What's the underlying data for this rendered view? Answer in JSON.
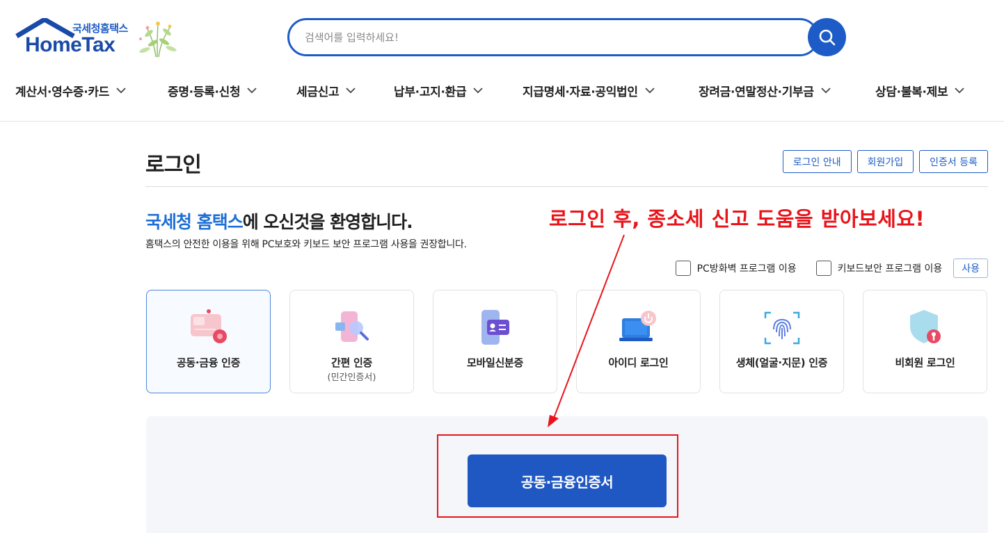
{
  "header": {
    "logo_sub": "국세청홈택스",
    "logo_main": "HomeTax",
    "search_placeholder": "검색어를 입력하세요!",
    "search_icon": "search-icon"
  },
  "nav": [
    {
      "label": "계산서·영수증·카드"
    },
    {
      "label": "증명·등록·신청"
    },
    {
      "label": "세금신고"
    },
    {
      "label": "납부·고지·환급"
    },
    {
      "label": "지급명세·자료·공익법인"
    },
    {
      "label": "장려금·연말정산·기부금"
    },
    {
      "label": "상담·불복·제보"
    }
  ],
  "login": {
    "title": "로그인",
    "buttons": {
      "guide": "로그인 안내",
      "join": "회원가입",
      "cert_register": "인증서 등록"
    },
    "welcome_accent": "국세청 홈택스",
    "welcome_rest": "에 오신것을 환영합니다.",
    "welcome_sub": "홈택스의 안전한 이용을 위해 PC보호와 키보드 보안 프로그램 사용을 권장합니다.",
    "check_firewall": "PC방화벽 프로그램 이용",
    "check_keyboard": "키보드보안 프로그램 이용",
    "use_button": "사용",
    "methods": [
      {
        "label": "공동·금융 인증",
        "sub": "",
        "icon": "certificate-card-icon"
      },
      {
        "label": "간편 인증",
        "sub": "(민간인증서)",
        "icon": "simple-auth-icon"
      },
      {
        "label": "모바일신분증",
        "sub": "",
        "icon": "mobile-id-icon"
      },
      {
        "label": "아이디 로그인",
        "sub": "",
        "icon": "laptop-power-icon"
      },
      {
        "label": "생체(얼굴·지문) 인증",
        "sub": "",
        "icon": "fingerprint-icon"
      },
      {
        "label": "비회원 로그인",
        "sub": "",
        "icon": "shield-key-icon"
      }
    ],
    "cert_button": "공동·금융인증서"
  },
  "annotation": {
    "text": "로그인 후, 종소세 신고 도움을 받아보세요!",
    "color": "#e8141b"
  },
  "colors": {
    "accent": "#1d5cc7",
    "welcome_accent": "#1d6fd6",
    "annotation": "#e8141b"
  }
}
